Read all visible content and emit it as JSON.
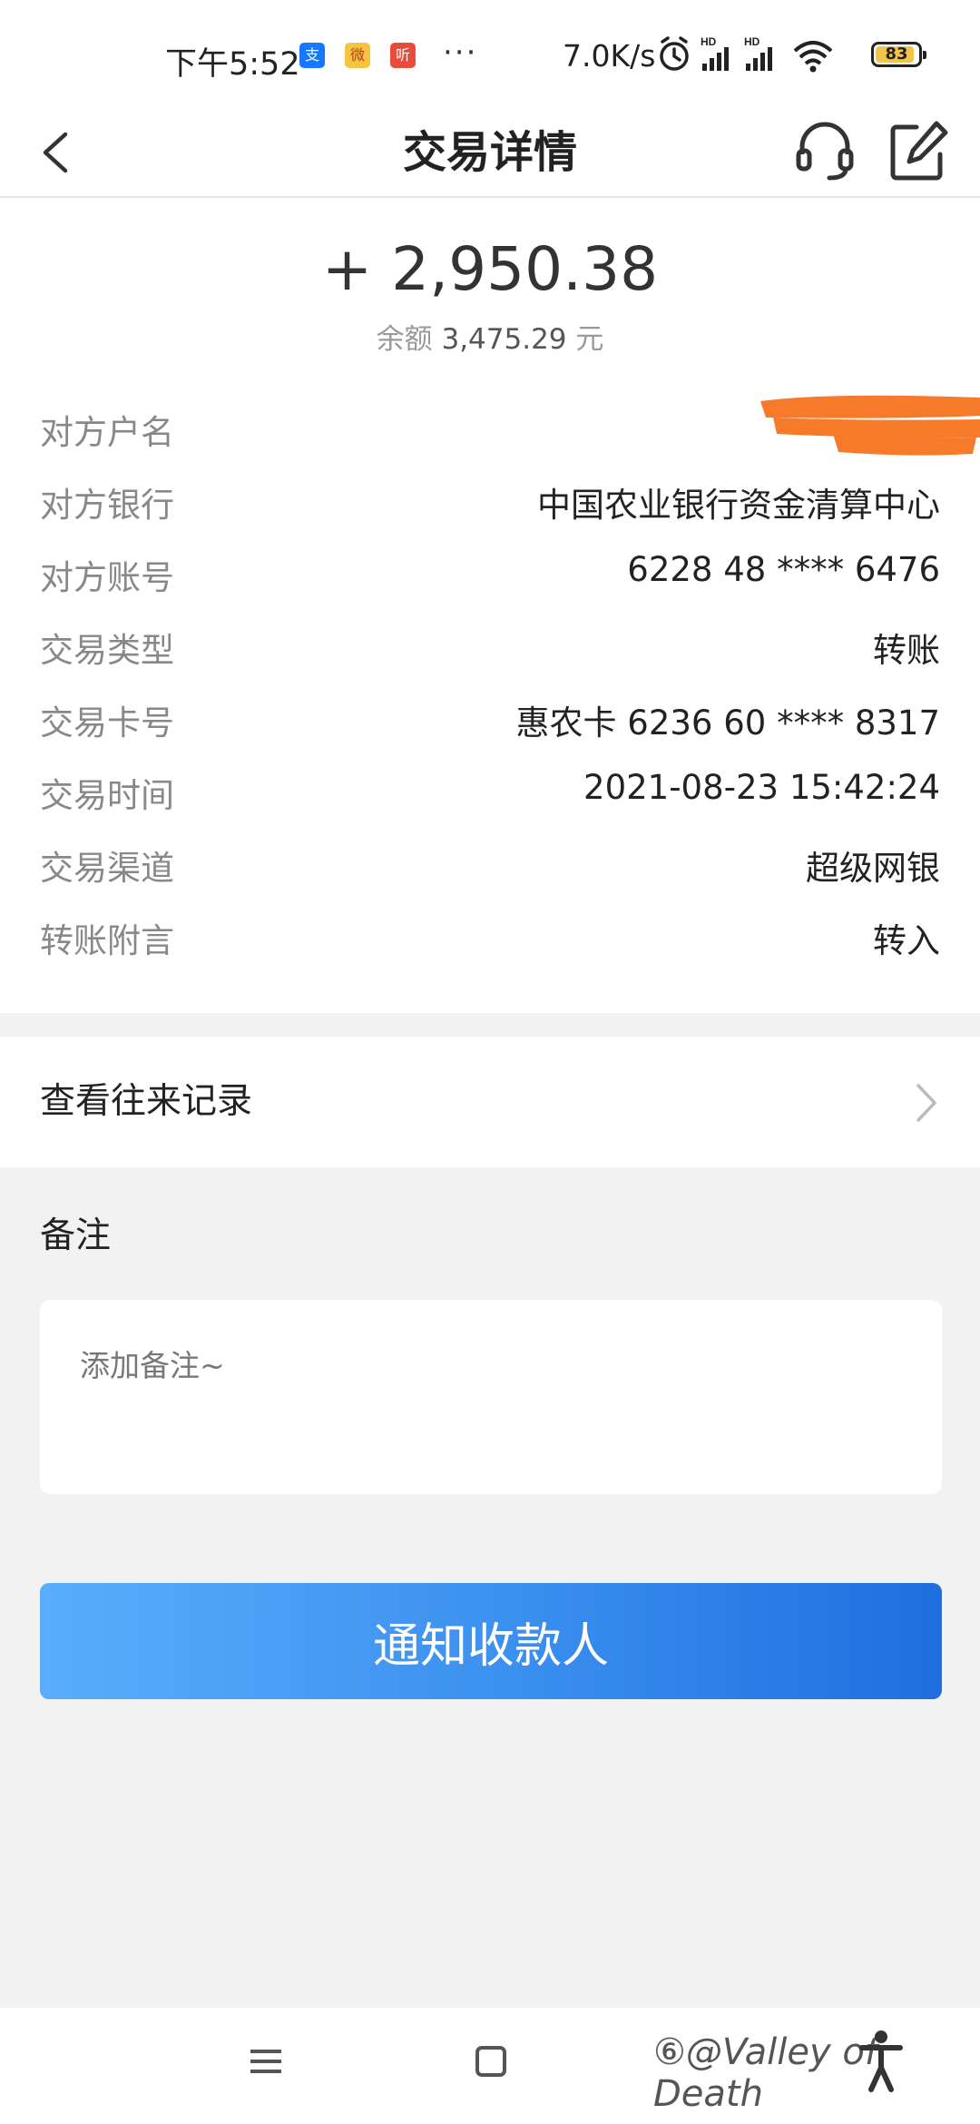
{
  "status_bar": {
    "time": "下午5:52",
    "dots": "···",
    "network_speed": "7.0K/s",
    "battery": "83",
    "apps": [
      "支",
      "微",
      "听"
    ]
  },
  "nav": {
    "title": "交易详情"
  },
  "transaction": {
    "amount": "+ 2,950.38",
    "balance_label": "余额",
    "balance_value": "3,475.29",
    "balance_unit": "元",
    "rows": [
      {
        "label": "对方户名",
        "value": ""
      },
      {
        "label": "对方银行",
        "value": "中国农业银行资金清算中心"
      },
      {
        "label": "对方账号",
        "value": "6228 48 **** 6476"
      },
      {
        "label": "交易类型",
        "value": "转账"
      },
      {
        "label": "交易卡号",
        "value": "惠农卡 6236 60 **** 8317"
      },
      {
        "label": "交易时间",
        "value": "2021-08-23 15:42:24"
      },
      {
        "label": "交易渠道",
        "value": "超级网银"
      },
      {
        "label": "转账附言",
        "value": "转入"
      }
    ]
  },
  "history_link": "查看往来记录",
  "remark": {
    "title": "备注",
    "placeholder": "添加备注~"
  },
  "notify_button": "通知收款人",
  "watermark": "⑥@Valley of Death",
  "colors": {
    "accent_start": "#5aadfc",
    "accent_end": "#1f6ee0",
    "redaction": "#f77a2a"
  }
}
